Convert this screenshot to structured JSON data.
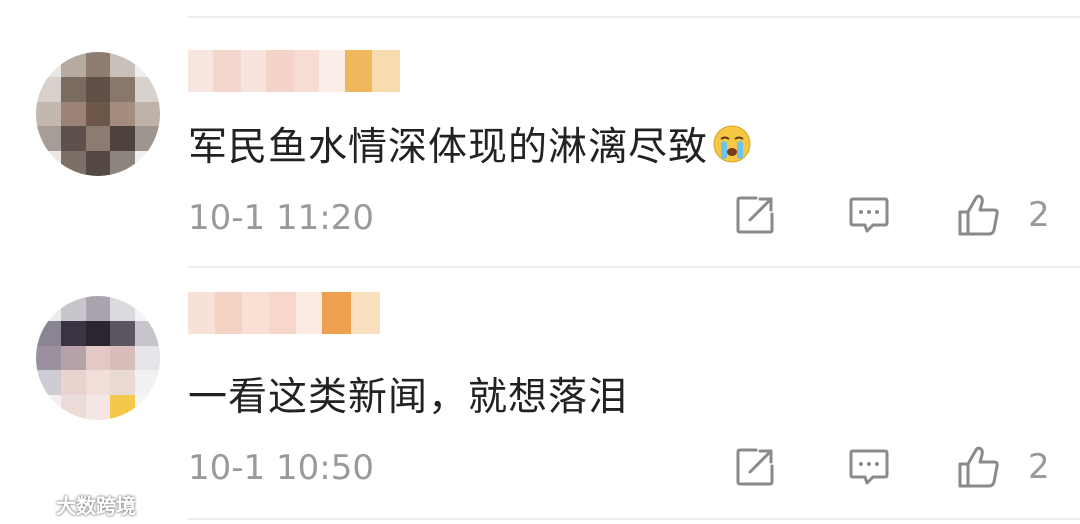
{
  "comments": [
    {
      "text": "军民鱼水情深体现的淋漓尽致",
      "emoji": "crying-face-emoji",
      "timestamp": "10-1 11:20",
      "like_count": "2"
    },
    {
      "text": "一看这类新闻，就想落泪",
      "timestamp": "10-1 10:50",
      "like_count": "2"
    }
  ],
  "watermark": {
    "text": "大数跨境"
  },
  "colors": {
    "text": "#222222",
    "meta": "#9a9a9a",
    "divider": "#ececec",
    "icon": "#8a8a8a"
  }
}
